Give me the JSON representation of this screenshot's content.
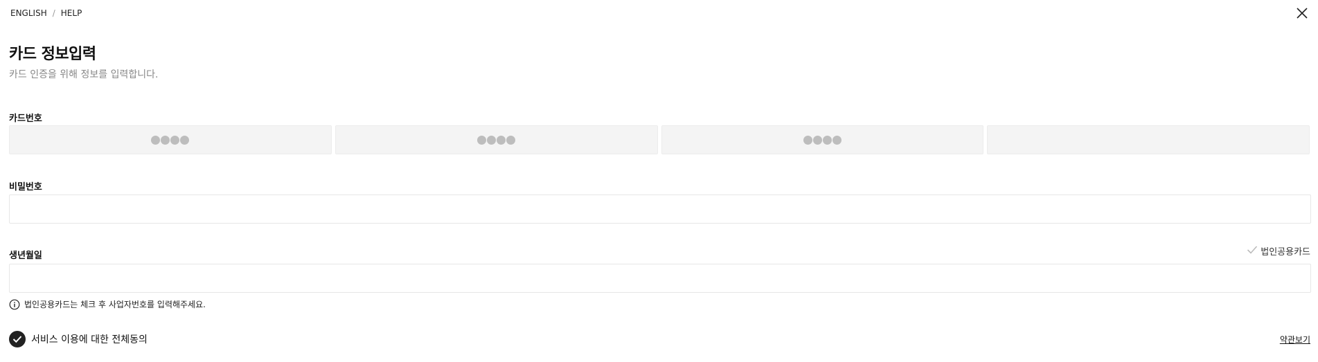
{
  "topbar": {
    "language": "ENGLISH",
    "separator": "/",
    "help": "HELP"
  },
  "header": {
    "title": "카드 정보입력",
    "subtitle": "카드 인증을 위해 정보를 입력합니다."
  },
  "card_number": {
    "label": "카드번호",
    "segments": [
      "●●●●",
      "●●●●",
      "●●●●",
      ""
    ]
  },
  "password": {
    "label": "비밀번호",
    "value": ""
  },
  "birthdate": {
    "label": "생년월일",
    "value": ""
  },
  "corporate_card": {
    "label": "법인공용카드",
    "checked": false
  },
  "notice": "법인공용카드는 체크 후 사업자번호를 입력해주세요.",
  "agreement": {
    "label": "서비스 이용에 대한 전체동의",
    "checked": true,
    "terms_link": "약관보기"
  },
  "icons": {
    "close": "close-icon",
    "check": "check-icon",
    "info": "info-icon",
    "check_circle": "check-circle-icon"
  }
}
